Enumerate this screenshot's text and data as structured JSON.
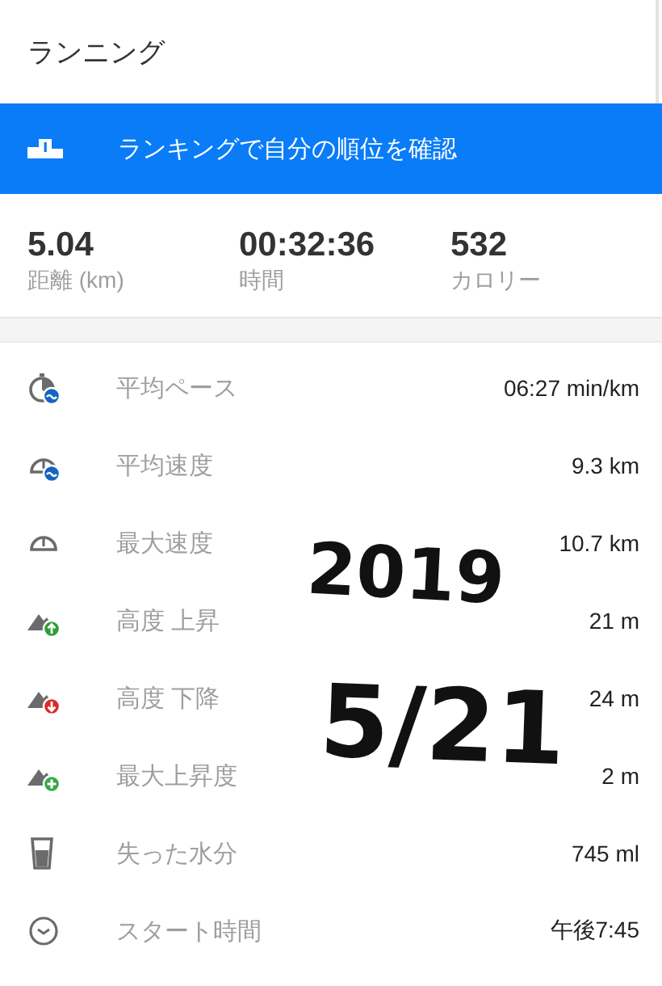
{
  "title": "ランニング",
  "banner": {
    "label": "ランキングで自分の順位を確認"
  },
  "summary": [
    {
      "value": "5.04",
      "label": "距離 (km)"
    },
    {
      "value": "00:32:36",
      "label": "時間"
    },
    {
      "value": "532",
      "label": "カロリー"
    }
  ],
  "stats": [
    {
      "kind": "pace",
      "label": "平均ペース",
      "value": "06:27 min/km"
    },
    {
      "kind": "avg_speed",
      "label": "平均速度",
      "value": "9.3 km"
    },
    {
      "kind": "max_speed",
      "label": "最大速度",
      "value": "10.7 km"
    },
    {
      "kind": "ascent",
      "label": "高度 上昇",
      "value": "21 m"
    },
    {
      "kind": "descent",
      "label": "高度 下降",
      "value": "24 m"
    },
    {
      "kind": "max_elevation",
      "label": "最大上昇度",
      "value": "2 m"
    },
    {
      "kind": "water",
      "label": "失った水分",
      "value": "745 ml"
    },
    {
      "kind": "clock",
      "label": "スタート時間",
      "value": "午後7:45"
    }
  ],
  "handwriting": [
    "2019",
    "5/21"
  ]
}
